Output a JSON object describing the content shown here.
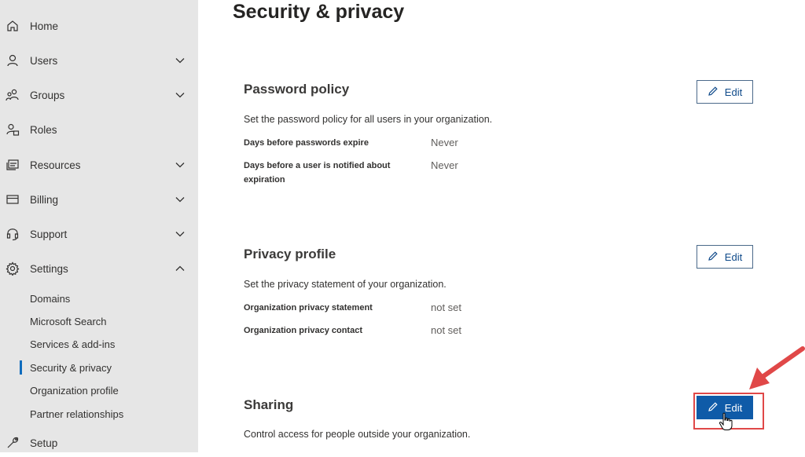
{
  "sidebar": {
    "items": [
      {
        "label": "Home",
        "icon": "home-icon"
      },
      {
        "label": "Users",
        "icon": "user-icon"
      },
      {
        "label": "Groups",
        "icon": "group-icon"
      },
      {
        "label": "Roles",
        "icon": "roles-icon"
      },
      {
        "label": "Resources",
        "icon": "resources-icon"
      },
      {
        "label": "Billing",
        "icon": "billing-icon"
      },
      {
        "label": "Support",
        "icon": "headset-icon"
      },
      {
        "label": "Settings",
        "icon": "gear-icon"
      }
    ],
    "settings_subitems": [
      {
        "label": "Domains"
      },
      {
        "label": "Microsoft Search"
      },
      {
        "label": "Services & add-ins"
      },
      {
        "label": "Security & privacy",
        "selected": true
      },
      {
        "label": "Organization profile"
      },
      {
        "label": "Partner relationships"
      }
    ],
    "setup": {
      "label": "Setup",
      "icon": "wrench-icon"
    }
  },
  "main": {
    "page_title": "Security & privacy",
    "sections": [
      {
        "title": "Password policy",
        "description": "Set the password policy for all users in your organization.",
        "edit_label": "Edit",
        "fields": [
          {
            "label": "Days before passwords expire",
            "value": "Never"
          },
          {
            "label": "Days before a user is notified about expiration",
            "value": "Never"
          }
        ]
      },
      {
        "title": "Privacy profile",
        "description": "Set the privacy statement of your organization.",
        "edit_label": "Edit",
        "fields": [
          {
            "label": "Organization privacy statement",
            "value": "not set"
          },
          {
            "label": "Organization privacy contact",
            "value": "not set"
          }
        ]
      },
      {
        "title": "Sharing",
        "description": "Control access for people outside your organization.",
        "edit_label": "Edit",
        "fields": []
      }
    ]
  },
  "colors": {
    "sidebar_bg": "#e6e6e6",
    "accent": "#0f5ba8",
    "highlight": "#e04848"
  }
}
